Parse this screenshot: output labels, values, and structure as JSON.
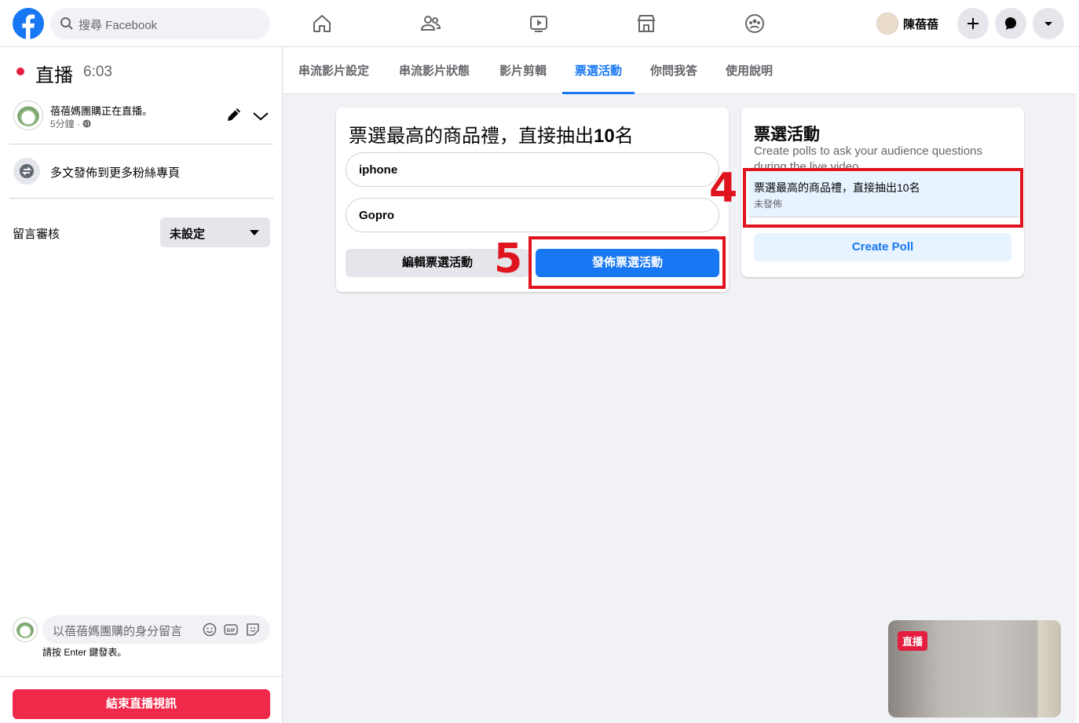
{
  "header": {
    "search_placeholder": "搜尋 Facebook",
    "user_name": "陳蓓蓓"
  },
  "left_panel": {
    "live_label": "直播",
    "live_time": "6:03",
    "page_status": "蓓蓓媽團購正在直播。",
    "page_time": "5分鐘 ·",
    "crosspost_label": "多文發佈到更多粉絲專頁",
    "moderation_label": "留言審核",
    "moderation_value": "未設定",
    "comment_placeholder": "以蓓蓓媽團購的身分留言",
    "enter_hint": "請按 Enter 鍵發表。",
    "end_button": "結束直播視訊"
  },
  "tabs": [
    {
      "label": "串流影片設定"
    },
    {
      "label": "串流影片狀態"
    },
    {
      "label": "影片剪輯"
    },
    {
      "label": "票選活動"
    },
    {
      "label": "你問我答"
    },
    {
      "label": "使用說明"
    }
  ],
  "poll_editor": {
    "question_prefix": "票選最高的商品禮，直接抽出",
    "question_number": "10",
    "question_suffix": "名",
    "options": [
      "iphone",
      "Gopro"
    ],
    "edit_button": "編輯票選活動",
    "publish_button": "發佈票選活動",
    "annotation": "5"
  },
  "poll_list": {
    "title": "票選活動",
    "description": "Create polls to ask your audience questions during the live video",
    "item_title": "票選最高的商品禮，直接抽出10名",
    "item_status": "未發佈",
    "create_button": "Create Poll",
    "annotation": "4"
  },
  "preview": {
    "badge": "直播"
  },
  "colors": {
    "brand": "#1877f2",
    "live_red": "#e41e3f",
    "end_button": "#f02849",
    "annotation_red": "#e0141e"
  }
}
